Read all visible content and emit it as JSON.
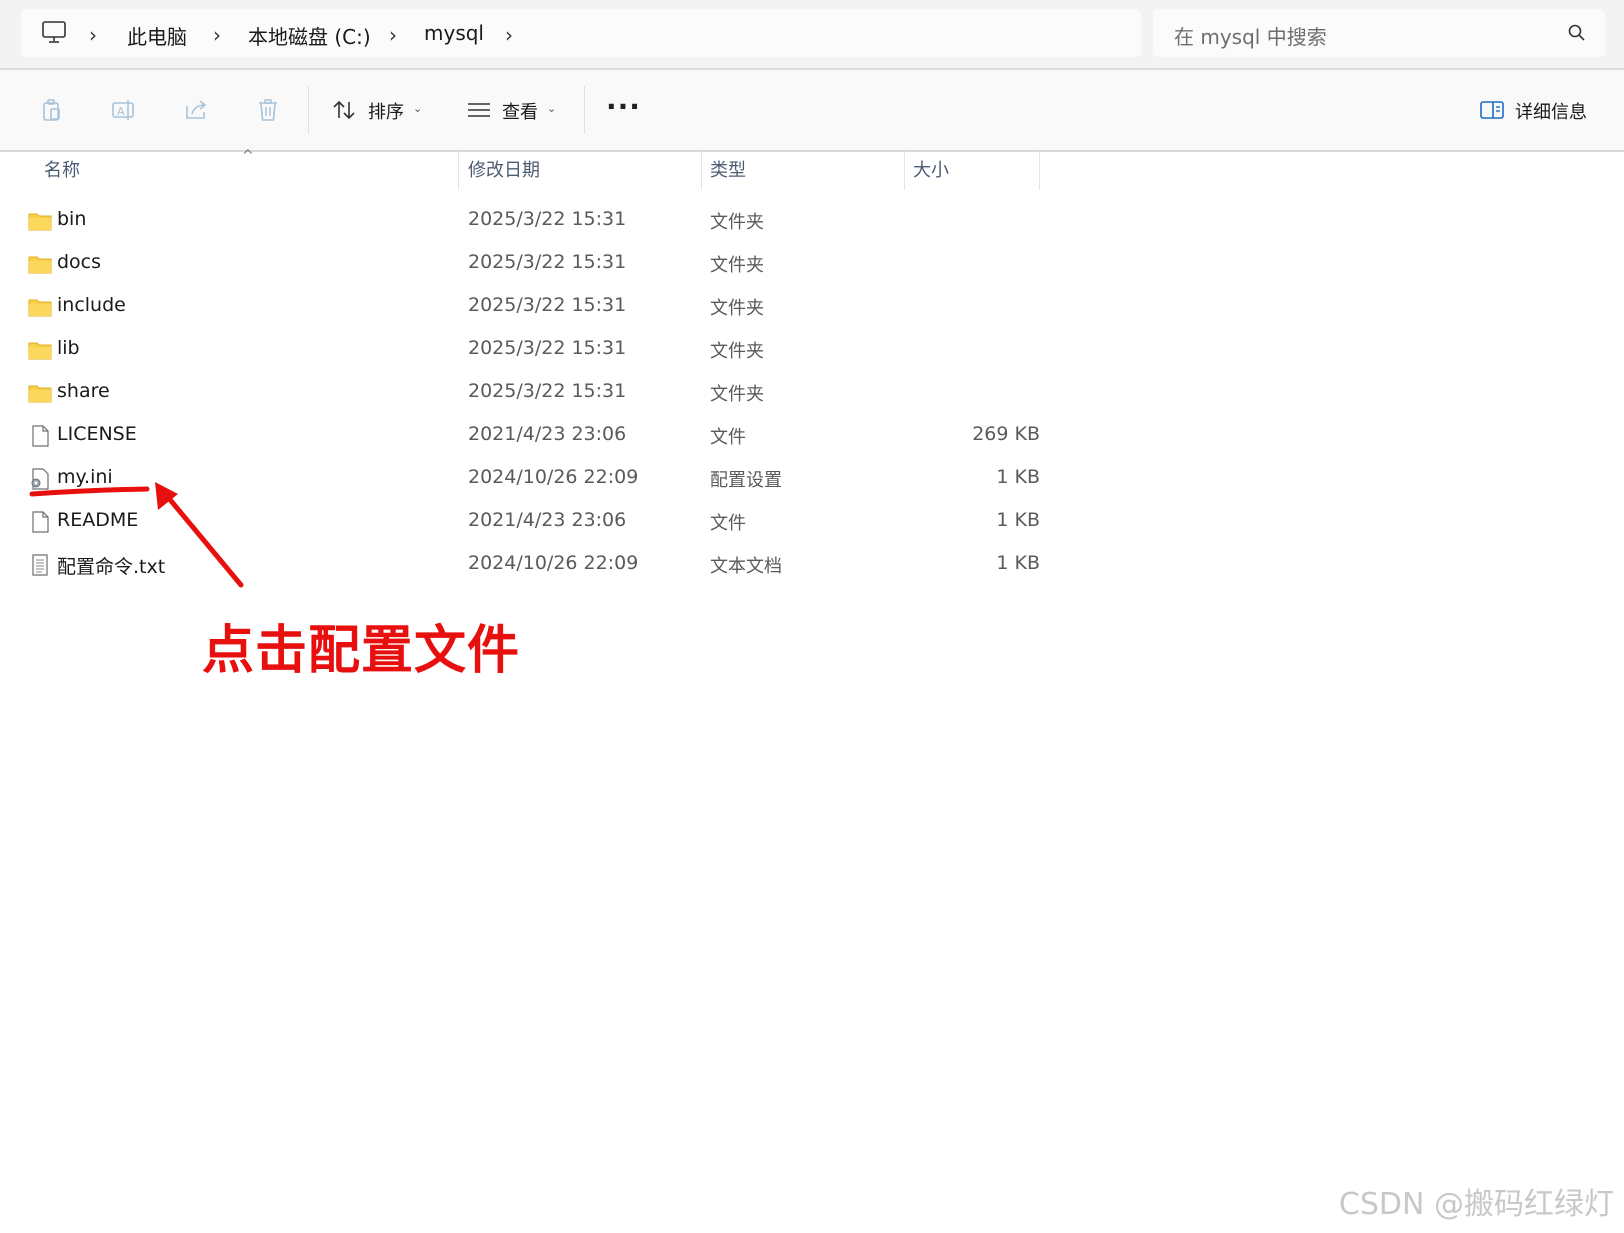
{
  "address_bar": {
    "pc_icon": "computer-icon",
    "crumbs": [
      "此电脑",
      "本地磁盘 (C:)",
      "mysql"
    ]
  },
  "search": {
    "placeholder": "在 mysql 中搜索",
    "icon": "search-icon"
  },
  "toolbar": {
    "copy_icon": "copy-icon",
    "rename_icon": "rename-icon",
    "share_icon": "share-icon",
    "delete_icon": "trash-icon",
    "sort_label": "排序",
    "view_label": "查看",
    "more_label": "···",
    "details_label": "详细信息"
  },
  "columns": {
    "name": "名称",
    "date": "修改日期",
    "type": "类型",
    "size": "大小"
  },
  "files": [
    {
      "name": "bin",
      "date": "2025/3/22 15:31",
      "type": "文件夹",
      "size": "",
      "icon": "folder-icon"
    },
    {
      "name": "docs",
      "date": "2025/3/22 15:31",
      "type": "文件夹",
      "size": "",
      "icon": "folder-icon"
    },
    {
      "name": "include",
      "date": "2025/3/22 15:31",
      "type": "文件夹",
      "size": "",
      "icon": "folder-icon"
    },
    {
      "name": "lib",
      "date": "2025/3/22 15:31",
      "type": "文件夹",
      "size": "",
      "icon": "folder-icon"
    },
    {
      "name": "share",
      "date": "2025/3/22 15:31",
      "type": "文件夹",
      "size": "",
      "icon": "folder-icon"
    },
    {
      "name": "LICENSE",
      "date": "2021/4/23 23:06",
      "type": "文件",
      "size": "269 KB",
      "icon": "file-icon"
    },
    {
      "name": "my.ini",
      "date": "2024/10/26 22:09",
      "type": "配置设置",
      "size": "1 KB",
      "icon": "config-file-icon"
    },
    {
      "name": "README",
      "date": "2021/4/23 23:06",
      "type": "文件",
      "size": "1 KB",
      "icon": "file-icon"
    },
    {
      "name": "配置命令.txt",
      "date": "2024/10/26 22:09",
      "type": "文本文档",
      "size": "1 KB",
      "icon": "text-file-icon"
    }
  ],
  "annotation": {
    "text": "点击配置文件",
    "color": "#e8100f"
  },
  "watermark": "CSDN @搬码红绿灯"
}
